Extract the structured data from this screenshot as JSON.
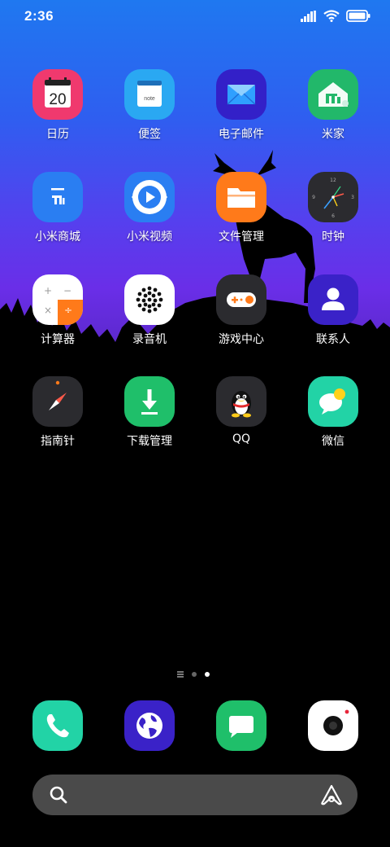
{
  "status_bar": {
    "time": "2:36",
    "icons": [
      "signal-icon",
      "wifi-icon",
      "battery-icon"
    ]
  },
  "apps": [
    {
      "label": "日历",
      "icon": "calendar-icon",
      "badge_text": "20",
      "color": "#f0396e"
    },
    {
      "label": "便签",
      "icon": "notes-icon",
      "badge_text": "note",
      "color": "#2aa8f2"
    },
    {
      "label": "电子邮件",
      "icon": "mail-icon",
      "color": "#3320c8"
    },
    {
      "label": "米家",
      "icon": "mijia-home-icon",
      "color": "#22b86a"
    },
    {
      "label": "小米商城",
      "icon": "mi-store-icon",
      "color": "#2a7ef2"
    },
    {
      "label": "小米视频",
      "icon": "mi-video-icon",
      "color": "#2a7ef2"
    },
    {
      "label": "文件管理",
      "icon": "folder-icon",
      "color": "#ff7a1a"
    },
    {
      "label": "时钟",
      "icon": "clock-icon",
      "color": "#2b2b2f"
    },
    {
      "label": "计算器",
      "icon": "calculator-icon",
      "color": "#ffffff"
    },
    {
      "label": "录音机",
      "icon": "recorder-icon",
      "color": "#ffffff"
    },
    {
      "label": "游戏中心",
      "icon": "gamepad-icon",
      "color": "#2b2b2f"
    },
    {
      "label": "联系人",
      "icon": "contacts-icon",
      "color": "#3a22c8"
    },
    {
      "label": "指南针",
      "icon": "compass-icon",
      "color": "#2b2b2f"
    },
    {
      "label": "下载管理",
      "icon": "download-icon",
      "color": "#1fbf6a"
    },
    {
      "label": "QQ",
      "icon": "qq-penguin-icon",
      "color": "#2b2b2f"
    },
    {
      "label": "微信",
      "icon": "wechat-icon",
      "color": "#22d3a6"
    }
  ],
  "page_indicator": {
    "pages": 2,
    "active": 2
  },
  "dock": [
    {
      "icon": "phone-icon",
      "color": "#22d3a6"
    },
    {
      "icon": "browser-globe-icon",
      "color": "#3a22c8"
    },
    {
      "icon": "messages-icon",
      "color": "#1fbf6a"
    },
    {
      "icon": "camera-icon",
      "color": "#ffffff"
    }
  ],
  "search_bar": {
    "icons": [
      "search-icon",
      "assistant-icon"
    ]
  }
}
